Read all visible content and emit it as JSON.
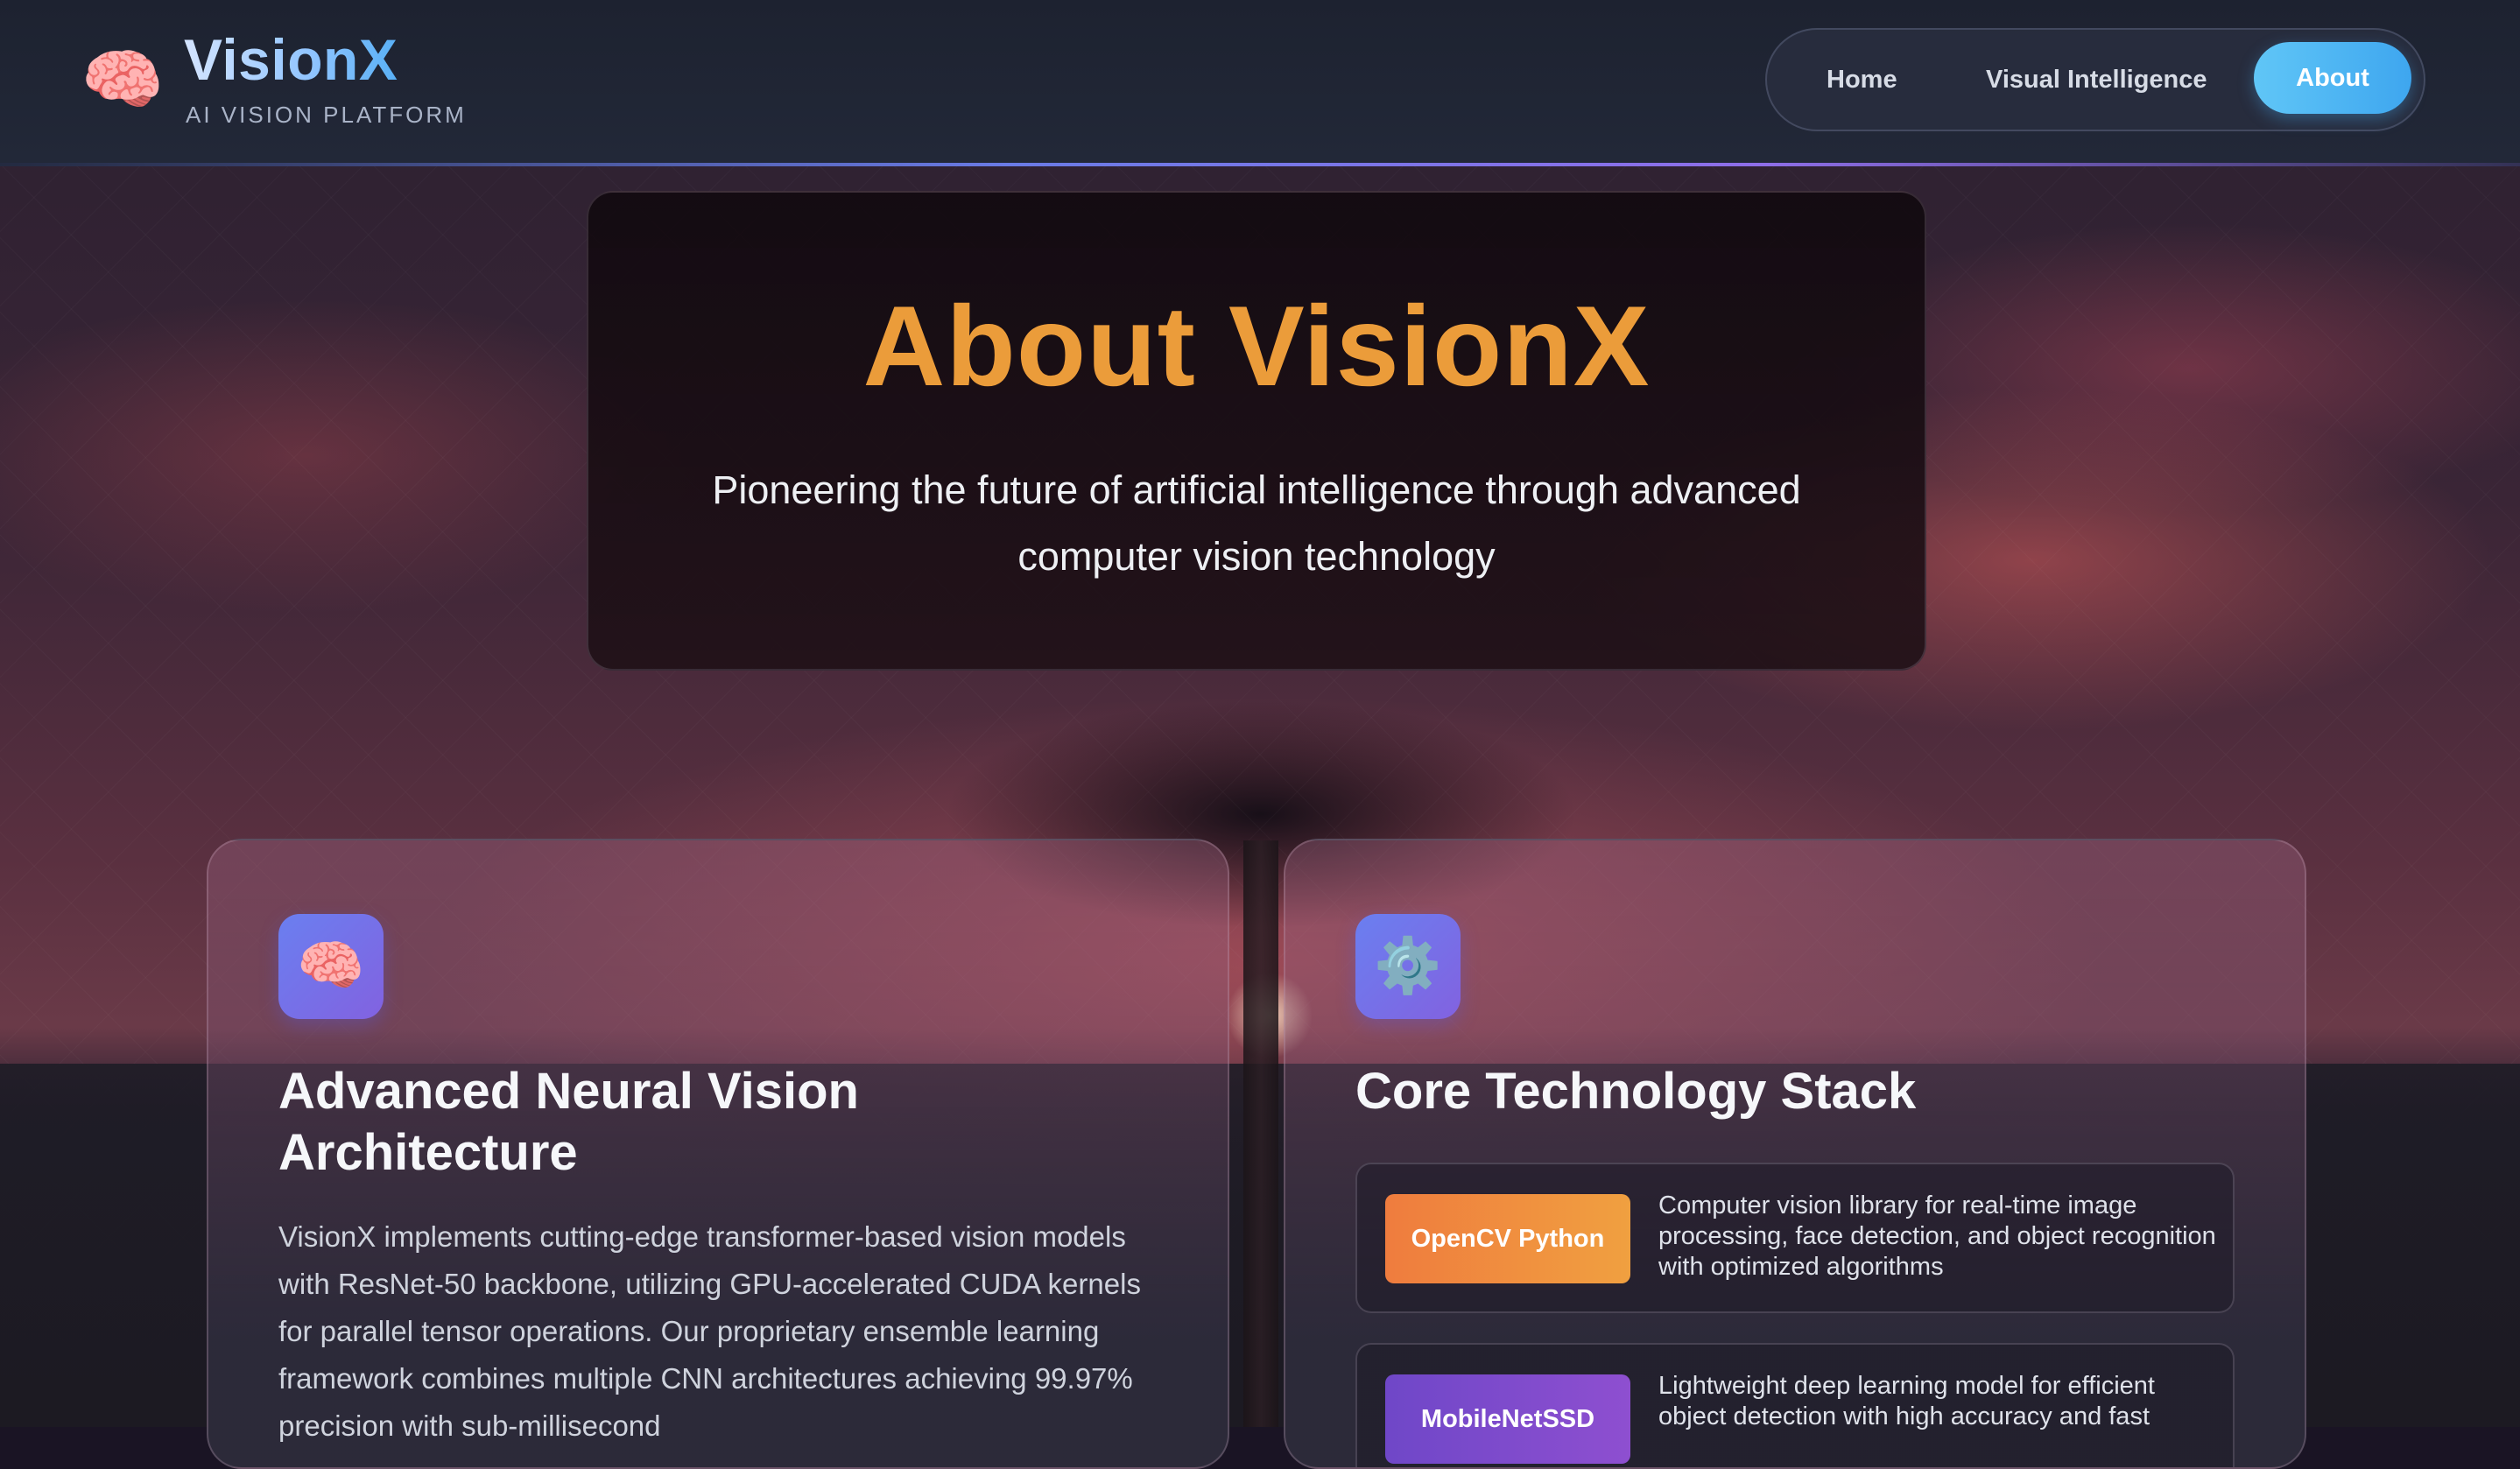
{
  "header": {
    "brand": "VisionX",
    "tagline": "AI VISION PLATFORM",
    "logo_icon": "brain-icon"
  },
  "nav": {
    "items": [
      {
        "label": "Home",
        "active": false
      },
      {
        "label": "Visual Intelligence",
        "active": false
      },
      {
        "label": "About",
        "active": true
      }
    ]
  },
  "hero": {
    "title": "About VisionX",
    "subtitle": "Pioneering the future of artificial intelligence through advanced computer vision technology"
  },
  "cards": [
    {
      "icon": "brain-icon",
      "title": "Advanced Neural Vision Architecture",
      "body": "VisionX implements cutting-edge transformer-based vision models with ResNet-50 backbone, utilizing GPU-accelerated CUDA kernels for parallel tensor operations. Our proprietary ensemble learning framework combines multiple CNN architectures achieving 99.97% precision with sub-millisecond"
    },
    {
      "icon": "gear-icon",
      "title": "Core Technology Stack",
      "stack": [
        {
          "badge": "OpenCV Python",
          "description": "Computer vision library for real-time image processing, face detection, and object recognition with optimized algorithms",
          "color": "#ef7c3e"
        },
        {
          "badge": "MobileNetSSD",
          "description": "Lightweight deep learning model for efficient object detection with high accuracy and fast",
          "color": "#6f47c8"
        }
      ]
    }
  ],
  "colors": {
    "accent_orange": "#eb9c3a",
    "nav_active": "#4fb6f2",
    "icon_tile": "#7070e8"
  }
}
